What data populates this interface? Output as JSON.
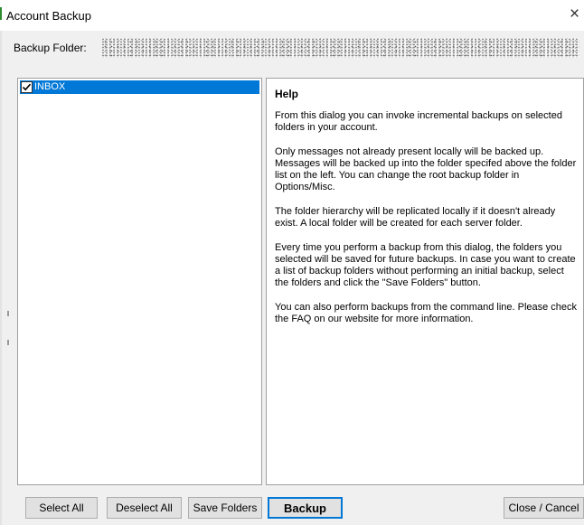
{
  "window": {
    "title": "Account Backup",
    "close_glyph": "×"
  },
  "backup_folder": {
    "label": "Backup Folder:",
    "value": ""
  },
  "folder_tree": {
    "items": [
      {
        "label": "INBOX",
        "checked": true,
        "selected": true
      }
    ]
  },
  "help": {
    "title": "Help",
    "paragraphs": [
      "From this dialog you can invoke incremental backups on selected folders in your account.",
      "Only messages not already present locally will be backed up. Messages will be backed up into the folder specifed above the folder list on the left. You can change the root backup folder in Options/Misc.",
      "The folder hierarchy will be replicated locally if it doesn't already exist. A local folder will be created for each server folder.",
      "Every time you perform a backup from this dialog, the folders you selected will be saved for future backups. In case you want to create a list of backup folders without performing an initial backup, select the folders and click the \"Save Folders\" button.",
      "You can also perform backups from the command line. Please check the FAQ on our website for more information."
    ]
  },
  "buttons": {
    "select_all": "Select All",
    "deselect_all": "Deselect All",
    "save_folders": "Save Folders",
    "backup": "Backup",
    "close_cancel": "Close / Cancel"
  },
  "colors": {
    "selection": "#0078d7",
    "dialog_bg": "#f0f0f0",
    "accent_green": "#2e8b2e"
  },
  "icons": {
    "close": "close-icon",
    "checkbox": "checkbox-checked-icon"
  }
}
